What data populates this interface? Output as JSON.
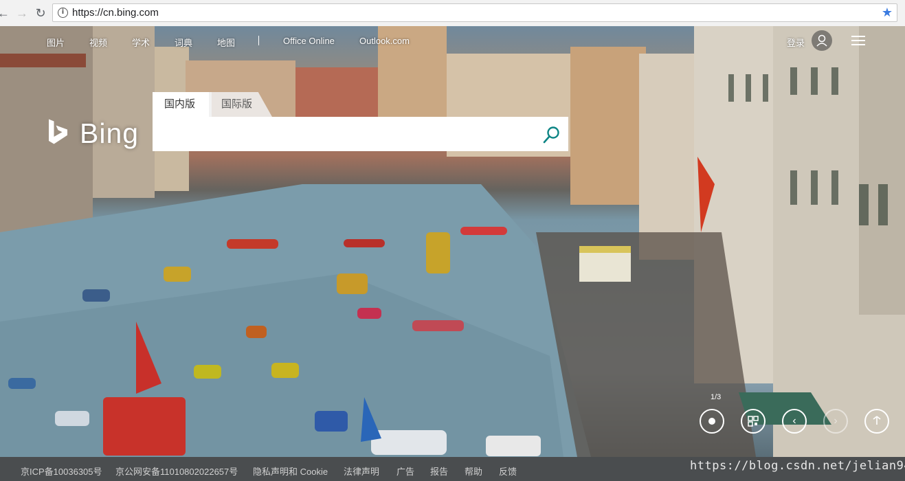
{
  "browser": {
    "url": "https://cn.bing.com"
  },
  "nav": {
    "items": [
      "图片",
      "视频",
      "学术",
      "词典",
      "地图"
    ],
    "separator": "|",
    "office": "Office Online",
    "outlook": "Outlook.com",
    "login": "登录"
  },
  "logo": {
    "text": "Bing"
  },
  "search": {
    "tab_domestic": "国内版",
    "tab_international": "国际版",
    "placeholder": ""
  },
  "carousel": {
    "counter": "1/3"
  },
  "footer": {
    "items": [
      "京ICP备10036305号",
      "京公网安备11010802022657号",
      "隐私声明和 Cookie",
      "法律声明",
      "广告",
      "报告",
      "帮助",
      "反馈"
    ],
    "watermark": "https://blog.csdn.net/jelian94"
  },
  "icons": {
    "back": "back-arrow-icon",
    "forward": "forward-arrow-icon",
    "reload": "reload-icon",
    "info": "info-icon",
    "star": "bookmark-star-icon",
    "search": "search-icon",
    "avatar": "user-avatar-icon",
    "menu": "hamburger-menu-icon"
  },
  "colors": {
    "search_icon": "#0c8484",
    "star": "#3a7be0",
    "footer_bg": "#4a4d4f"
  }
}
